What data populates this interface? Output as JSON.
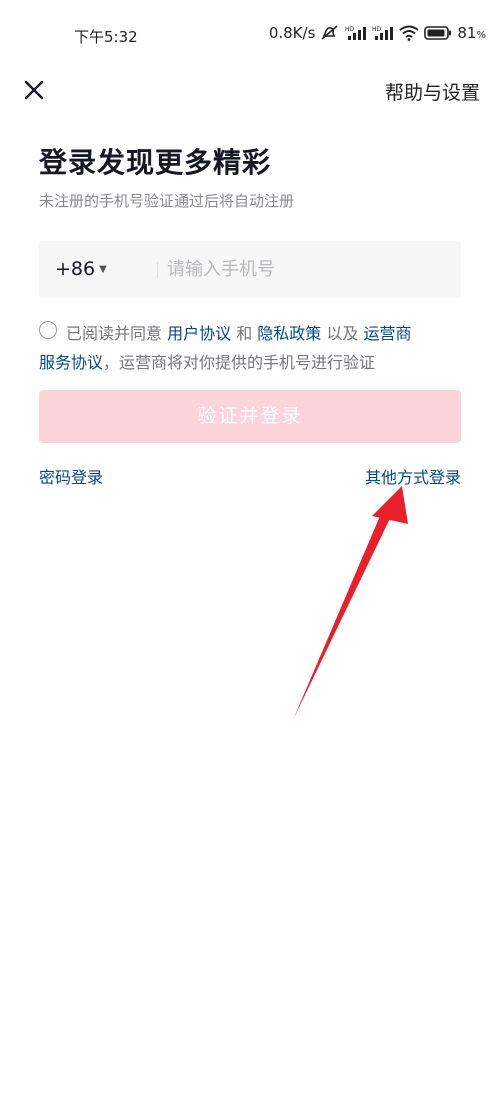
{
  "status_bar": {
    "time": "下午5:32",
    "net_speed": "0.8K/s",
    "battery": "81"
  },
  "header": {
    "close_icon": "close-icon",
    "help_label": "帮助与设置"
  },
  "main": {
    "title": "登录发现更多精彩",
    "subtitle": "未注册的手机号验证通过后将自动注册",
    "country_code": "+86",
    "phone_placeholder": "请输入手机号",
    "phone_value": ""
  },
  "agreement": {
    "checked": false,
    "prefix": "已阅读并同意 ",
    "user_agreement": "用户协议",
    "and": " 和 ",
    "privacy_policy": "隐私政策",
    "also": " 以及 ",
    "operator_part1": "运营商",
    "operator_part2": "服务协议",
    "suffix": "，运营商将对你提供的手机号进行验证"
  },
  "actions": {
    "login_label": "验证并登录",
    "password_login": "密码登录",
    "other_login": "其他方式登录"
  },
  "colors": {
    "link": "#04498d",
    "login_button_disabled": "#fdd3dc",
    "annotation_arrow": "#e8202a"
  }
}
